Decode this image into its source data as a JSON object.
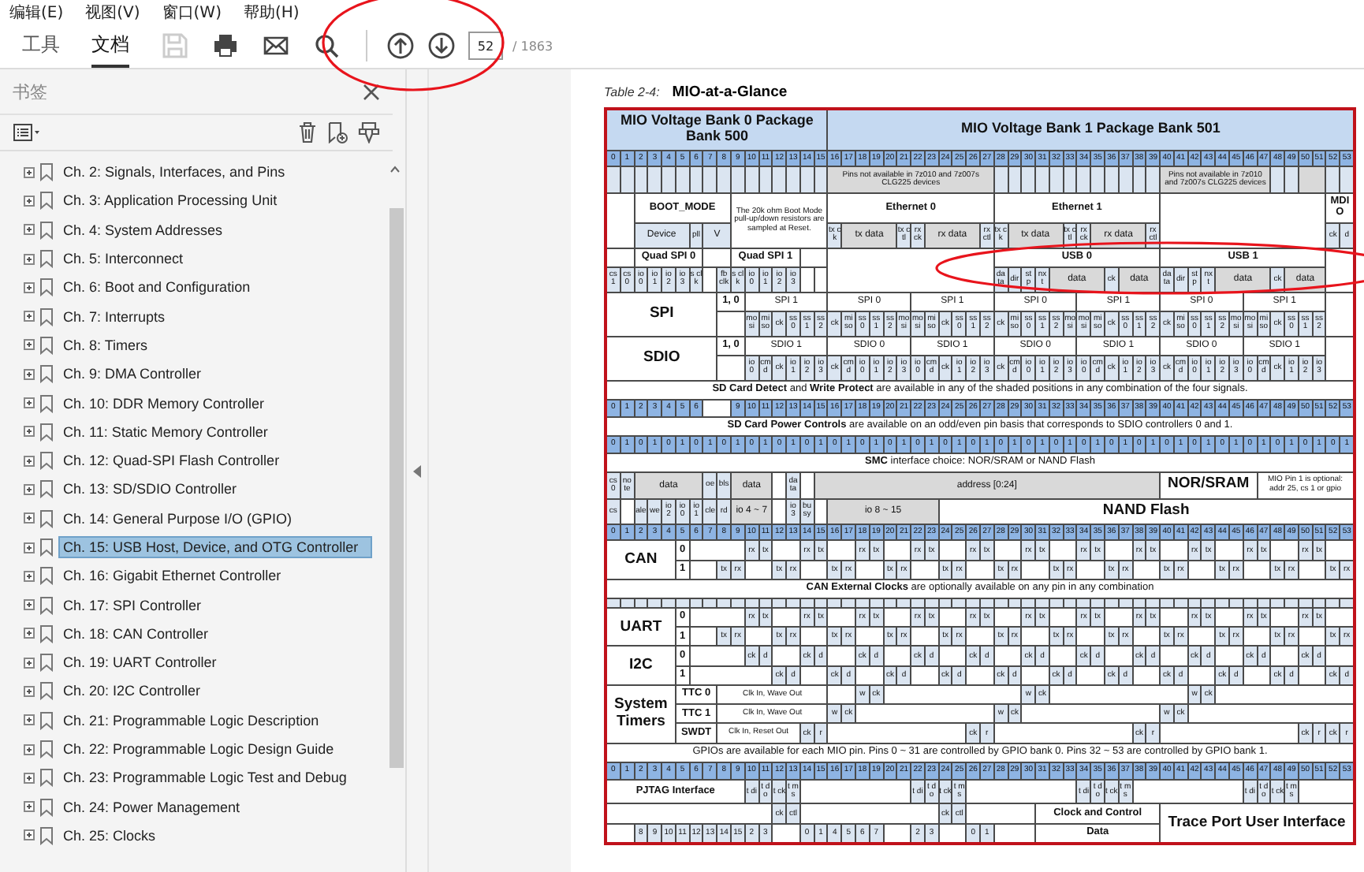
{
  "menu": [
    "编辑(E)",
    "视图(V)",
    "窗口(W)",
    "帮助(H)"
  ],
  "toolbar": {
    "tabs": [
      {
        "label": "工具",
        "selected": false
      },
      {
        "label": "文档",
        "selected": true
      }
    ],
    "tools": [
      {
        "kind": "save",
        "disabled": true
      },
      {
        "kind": "print",
        "disabled": false
      },
      {
        "kind": "mail",
        "disabled": false
      },
      {
        "kind": "search",
        "disabled": false
      }
    ],
    "nav": [
      {
        "kind": "up"
      },
      {
        "kind": "down"
      }
    ],
    "page_field": {
      "value": "52"
    },
    "page_total": "/ 1863"
  },
  "bookmarks": {
    "title": "书签",
    "items": [
      {
        "label": "Ch. 2: Signals, Interfaces, and Pins",
        "selected": false
      },
      {
        "label": "Ch. 3: Application Processing Unit",
        "selected": false
      },
      {
        "label": "Ch. 4: System Addresses",
        "selected": false
      },
      {
        "label": "Ch. 5: Interconnect",
        "selected": false
      },
      {
        "label": "Ch. 6: Boot and Configuration",
        "selected": false
      },
      {
        "label": "Ch. 7: Interrupts",
        "selected": false
      },
      {
        "label": "Ch. 8: Timers",
        "selected": false
      },
      {
        "label": "Ch. 9: DMA Controller",
        "selected": false
      },
      {
        "label": "Ch. 10: DDR Memory Controller",
        "selected": false
      },
      {
        "label": "Ch. 11: Static Memory Controller",
        "selected": false
      },
      {
        "label": "Ch. 12: Quad-SPI Flash Controller",
        "selected": false
      },
      {
        "label": "Ch. 13: SD/SDIO Controller",
        "selected": false
      },
      {
        "label": "Ch. 14: General Purpose I/O (GPIO)",
        "selected": false
      },
      {
        "label": "Ch. 15: USB Host, Device, and OTG Controller",
        "selected": true
      },
      {
        "label": "Ch. 16: Gigabit Ethernet Controller",
        "selected": false
      },
      {
        "label": "Ch. 17: SPI Controller",
        "selected": false
      },
      {
        "label": "Ch. 18: CAN Controller",
        "selected": false
      },
      {
        "label": "Ch. 19: UART Controller",
        "selected": false
      },
      {
        "label": "Ch. 20: I2C Controller",
        "selected": false
      },
      {
        "label": "Ch. 21: Programmable Logic Description",
        "selected": false
      },
      {
        "label": "Ch. 22: Programmable Logic Design Guide",
        "selected": false
      },
      {
        "label": "Ch. 23: Programmable Logic Test and Debug",
        "selected": false
      },
      {
        "label": "Ch. 24: Power Management",
        "selected": false
      },
      {
        "label": "Ch. 25: Clocks",
        "selected": false
      }
    ]
  },
  "document": {
    "caption": "Table 2-4:",
    "title": "MIO-at-a-Glance",
    "rows": [
      {
        "kind": "bank-header",
        "cells": [
          "MIO Voltage Bank 0 Package Bank 500",
          "MIO Voltage Bank 1 Package Bank 501"
        ]
      },
      {
        "kind": "pin-numbers",
        "cells": [
          "0",
          "1",
          "2",
          "3",
          "4",
          "5",
          "6",
          "7",
          "8",
          "9",
          "10",
          "11",
          "12",
          "13",
          "14",
          "15",
          "16",
          "17",
          "18",
          "19",
          "20",
          "21",
          "22",
          "23",
          "24",
          "25",
          "26",
          "27",
          "28",
          "29",
          "30",
          "31",
          "32",
          "33",
          "34",
          "35",
          "36",
          "37",
          "38",
          "39",
          "40",
          "41",
          "42",
          "43",
          "44",
          "45",
          "46",
          "47",
          "48",
          "49",
          "50",
          "51",
          "52",
          "53"
        ]
      },
      {
        "kind": "reserved-pins",
        "cells": [
          "Pins not available in 7z010 and 7z007s CLG225 devices",
          "Pins not available in 7z010 and 7z007s CLG225 devices"
        ]
      },
      {
        "kind": "boot",
        "cells": [
          "BOOT_MODE",
          "The 20k ohm Boot Mode pull-up/down resistors are sampled at Reset.",
          "Ethernet 0",
          "Ethernet 1",
          "MDIO",
          "Device",
          "pll",
          "V",
          "tx ck",
          "tx data",
          "tx ctl",
          "rx ck",
          "rx data",
          "rx ctl",
          "tx ck",
          "tx data",
          "tx ctl",
          "rx ck",
          "rx data",
          "rx ctl",
          "ck",
          "d"
        ]
      },
      {
        "kind": "quad-spi",
        "cells": [
          "Quad SPI 0",
          "Quad SPI 1",
          "USB 0",
          "USB 1",
          "cs 1",
          "cs 0",
          "io 0",
          "io 1",
          "io 2",
          "io 3",
          "s clk",
          "fb clk",
          "s clk",
          "io 0",
          "io 1",
          "io 2",
          "io 3",
          "da ta",
          "dir",
          "st p",
          "nx t",
          "data",
          "ck",
          "data",
          "da ta",
          "dir",
          "st p",
          "nx t",
          "data",
          "ck",
          "data"
        ]
      },
      {
        "kind": "spi",
        "cells": [
          "SPI",
          "1, 0",
          "SPI 1",
          "SPI 0",
          "SPI 1",
          "SPI 0",
          "SPI 1",
          "SPI 0",
          "SPI 1",
          "mo si",
          "mi so",
          "ck",
          "ss 0",
          "ss 1",
          "ss 2",
          "ck",
          "mi so",
          "ss 0",
          "ss 1",
          "ss 2",
          "mo si",
          "mo si",
          "mi so",
          "ck",
          "ss 0",
          "ss 1",
          "ss 2",
          "ck",
          "mi so",
          "ss 0",
          "ss 1",
          "ss 2",
          "mo si",
          "mo si",
          "mi so",
          "ck",
          "ss 0",
          "ss 1",
          "ss 2",
          "ck",
          "mi so",
          "ss 0",
          "ss 1",
          "ss 2",
          "mo si",
          "mo si",
          "mi so",
          "ck",
          "ss 0",
          "ss 1",
          "ss 2"
        ]
      },
      {
        "kind": "spi",
        "cells": [
          "SDIO",
          "1, 0",
          "SDIO 1",
          "SDIO 0",
          "SDIO 1",
          "SDIO 0",
          "SDIO 1",
          "SDIO 0",
          "SDIO 1",
          "io 0",
          "cmd",
          "ck",
          "io 1",
          "io 2",
          "io 3",
          "ck",
          "cmd",
          "io 0",
          "io 1",
          "io 2",
          "io 3",
          "io 0",
          "cmd",
          "ck",
          "io 1",
          "io 2",
          "io 3",
          "ck",
          "cmd",
          "io 0",
          "io 1",
          "io 2",
          "io 3",
          "io 0",
          "cmd",
          "ck",
          "io 1",
          "io 2",
          "io 3",
          "ck",
          "cmd",
          "io 0",
          "io 1",
          "io 2",
          "io 3",
          "io 0",
          "cmd",
          "ck",
          "io 1",
          "io 2",
          "io 3"
        ]
      },
      {
        "kind": "note",
        "text": "**SD Card Detect** and **Write Protect** are available in any of the shaded positions in any combination of the four signals."
      },
      {
        "kind": "detect-pins",
        "cells": [
          "0",
          "1",
          "2",
          "3",
          "4",
          "5",
          "6",
          "9",
          "10",
          "11",
          "12",
          "13",
          "14",
          "15",
          "16",
          "17",
          "18",
          "19",
          "20",
          "21",
          "22",
          "23",
          "24",
          "25",
          "26",
          "27",
          "28",
          "29",
          "30",
          "31",
          "32",
          "33",
          "34",
          "35",
          "36",
          "37",
          "38",
          "39",
          "40",
          "41",
          "42",
          "43",
          "44",
          "45",
          "46",
          "47",
          "48",
          "49",
          "50",
          "51",
          "52",
          "53"
        ]
      },
      {
        "kind": "note",
        "text": "**SD Card Power Controls** are available on an odd/even pin basis that corresponds to SDIO controllers 0 and 1."
      },
      {
        "kind": "pin-numbers",
        "cells": [
          "0",
          "1",
          "0",
          "1",
          "0",
          "1",
          "0",
          "1",
          "0",
          "1",
          "0",
          "1",
          "0",
          "1",
          "0",
          "1",
          "0",
          "1",
          "0",
          "1",
          "0",
          "1",
          "0",
          "1",
          "0",
          "1",
          "0",
          "1",
          "0",
          "1",
          "0",
          "1",
          "0",
          "1",
          "0",
          "1",
          "0",
          "1",
          "0",
          "1",
          "0",
          "1",
          "0",
          "1",
          "0",
          "1",
          "0",
          "1",
          "0",
          "1",
          "0",
          "1",
          "0",
          "1"
        ]
      },
      {
        "kind": "note",
        "text": "**SMC** interface choice: NOR/SRAM or NAND Flash"
      },
      {
        "kind": "smc",
        "cells": [
          "cs 0",
          "no te",
          "data",
          "oe",
          "bls",
          "data",
          "da ta",
          "address [0:24]",
          "NOR/SRAM",
          "MIO Pin 1 is optional: addr 25, cs 1 or gpio",
          "cs",
          "ale",
          "we",
          "io 2",
          "io 0",
          "io 1",
          "cle",
          "rd",
          "io 4 ~ 7",
          "io 3",
          "bu sy",
          "io 8 ~ 15",
          "NAND Flash"
        ]
      },
      {
        "kind": "pin-numbers",
        "cells": [
          "0",
          "1",
          "2",
          "3",
          "4",
          "5",
          "6",
          "7",
          "8",
          "9",
          "10",
          "11",
          "12",
          "13",
          "14",
          "15",
          "16",
          "17",
          "18",
          "19",
          "20",
          "21",
          "22",
          "23",
          "24",
          "25",
          "26",
          "27",
          "28",
          "29",
          "30",
          "31",
          "32",
          "33",
          "34",
          "35",
          "36",
          "37",
          "38",
          "39",
          "40",
          "41",
          "42",
          "43",
          "44",
          "45",
          "46",
          "47",
          "48",
          "49",
          "50",
          "51",
          "52",
          "53"
        ]
      },
      {
        "kind": "serial",
        "cells": [
          "CAN",
          "0",
          "rx",
          "tx",
          "rx",
          "tx",
          "rx",
          "tx",
          "rx",
          "tx",
          "rx",
          "tx",
          "rx",
          "tx",
          "rx",
          "tx",
          "rx",
          "tx",
          "rx",
          "tx",
          "rx",
          "tx",
          "rx",
          "tx",
          "1",
          "tx",
          "rx",
          "tx",
          "rx",
          "tx",
          "rx",
          "tx",
          "rx",
          "tx",
          "rx",
          "tx",
          "rx",
          "tx",
          "rx",
          "tx",
          "rx",
          "tx",
          "rx",
          "tx",
          "rx",
          "tx",
          "rx",
          "tx",
          "rx"
        ]
      },
      {
        "kind": "note",
        "text": "**CAN External Clocks** are optionally available on any pin in any combination"
      },
      {
        "kind": "blank-pins"
      },
      {
        "kind": "serial",
        "cells": [
          "UART",
          "0",
          "rx",
          "tx",
          "rx",
          "tx",
          "rx",
          "tx",
          "rx",
          "tx",
          "rx",
          "tx",
          "rx",
          "tx",
          "rx",
          "tx",
          "rx",
          "tx",
          "rx",
          "tx",
          "rx",
          "tx",
          "rx",
          "tx",
          "1",
          "tx",
          "rx",
          "tx",
          "rx",
          "tx",
          "rx",
          "tx",
          "rx",
          "tx",
          "rx",
          "tx",
          "rx",
          "tx",
          "rx",
          "tx",
          "rx",
          "tx",
          "rx",
          "tx",
          "rx",
          "tx",
          "rx",
          "tx",
          "rx"
        ]
      },
      {
        "kind": "i2c",
        "cells": [
          "I2C",
          "0",
          "ck",
          "d",
          "ck",
          "d",
          "ck",
          "d",
          "ck",
          "d",
          "ck",
          "d",
          "ck",
          "d",
          "ck",
          "d",
          "ck",
          "d",
          "ck",
          "d",
          "ck",
          "d",
          "ck",
          "d",
          "1",
          "ck",
          "d",
          "ck",
          "d",
          "ck",
          "d",
          "ck",
          "d",
          "ck",
          "d",
          "ck",
          "d",
          "ck",
          "d",
          "ck",
          "d",
          "ck",
          "d",
          "ck",
          "d",
          "ck",
          "d"
        ]
      },
      {
        "kind": "timers",
        "cells": [
          "System Timers",
          "TTC 0",
          "Clk In, Wave Out",
          "w",
          "ck",
          "w",
          "ck",
          "w",
          "ck",
          "TTC 1",
          "Clk In, Wave Out",
          "w",
          "ck",
          "w",
          "ck",
          "w",
          "ck",
          "SWDT",
          "Clk In, Reset Out",
          "ck",
          "r",
          "ck",
          "r",
          "ck",
          "r",
          "ck",
          "r",
          "ck",
          "r"
        ]
      },
      {
        "kind": "note",
        "text": "GPIOs are available for each MIO pin. Pins 0 ~ 31 are controlled by GPIO bank 0. Pins 32 ~ 53 are controlled by GPIO bank 1."
      },
      {
        "kind": "pin-numbers",
        "cells": [
          "0",
          "1",
          "2",
          "3",
          "4",
          "5",
          "6",
          "7",
          "8",
          "9",
          "10",
          "11",
          "12",
          "13",
          "14",
          "15",
          "16",
          "17",
          "18",
          "19",
          "20",
          "21",
          "22",
          "23",
          "24",
          "25",
          "26",
          "27",
          "28",
          "29",
          "30",
          "31",
          "32",
          "33",
          "34",
          "35",
          "36",
          "37",
          "38",
          "39",
          "40",
          "41",
          "42",
          "43",
          "44",
          "45",
          "46",
          "47",
          "48",
          "49",
          "50",
          "51",
          "52",
          "53"
        ]
      },
      {
        "kind": "pjtag",
        "cells": [
          "PJTAG Interface",
          "t di",
          "t do",
          "t ck",
          "t ms",
          "t di",
          "t do",
          "t ck",
          "t ms",
          "t di",
          "t do",
          "t ck",
          "t ms",
          "t di",
          "t do",
          "t ck",
          "t ms"
        ]
      },
      {
        "kind": "trace",
        "cells": [
          "ck",
          "ctl",
          "ck",
          "ctl",
          "Clock and Control",
          "Trace Port User Interface",
          "8",
          "9",
          "10",
          "11",
          "12",
          "13",
          "14",
          "15",
          "2",
          "3",
          "0",
          "1",
          "4",
          "5",
          "6",
          "7",
          "2",
          "3",
          "0",
          "1",
          "Data"
        ]
      }
    ]
  }
}
